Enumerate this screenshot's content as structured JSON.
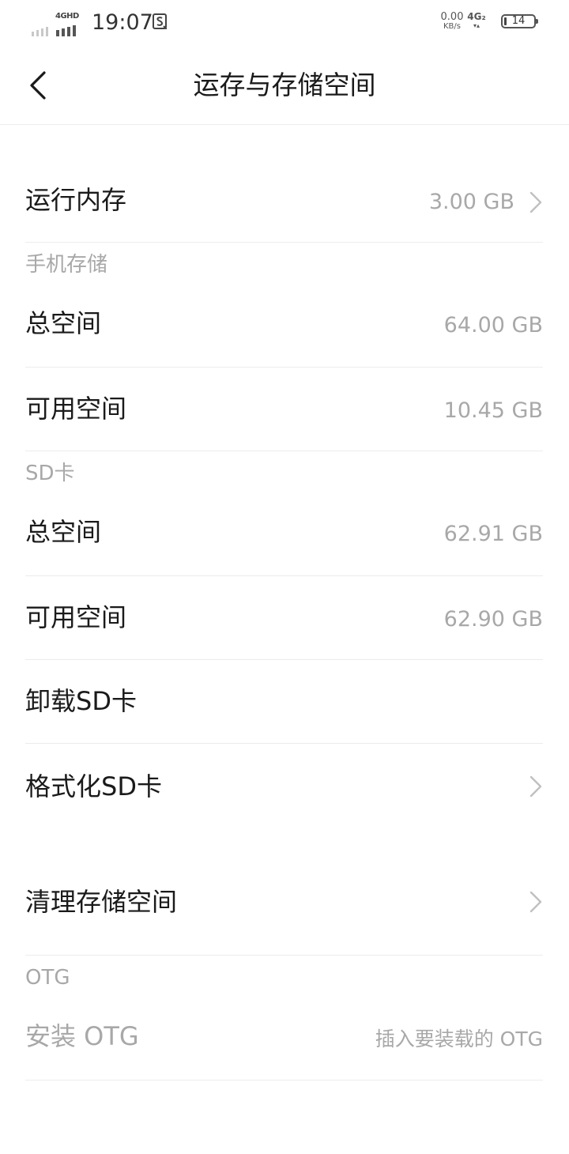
{
  "status_bar": {
    "net_tag": "4GHD",
    "time": "19:07",
    "speed_value": "0.00",
    "speed_unit": "KB/s",
    "net_type": "4G₂",
    "battery": "14"
  },
  "header": {
    "title": "运存与存储空间",
    "back_icon": "chevron-left-icon"
  },
  "ram": {
    "label": "运行内存",
    "value": "3.00 GB"
  },
  "phone_storage": {
    "section": "手机存储",
    "total_label": "总空间",
    "total_value": "64.00 GB",
    "available_label": "可用空间",
    "available_value": "10.45 GB"
  },
  "sd_card": {
    "section": "SD卡",
    "total_label": "总空间",
    "total_value": "62.91 GB",
    "available_label": "可用空间",
    "available_value": "62.90 GB",
    "unmount_label": "卸载SD卡",
    "format_label": "格式化SD卡"
  },
  "cleanup": {
    "label": "清理存储空间"
  },
  "otg": {
    "section": "OTG",
    "install_label": "安装 OTG",
    "install_hint": "插入要装载的 OTG"
  },
  "colors": {
    "text_primary": "#1a1a1a",
    "text_secondary": "#a8a8a8",
    "divider": "#ececec"
  }
}
